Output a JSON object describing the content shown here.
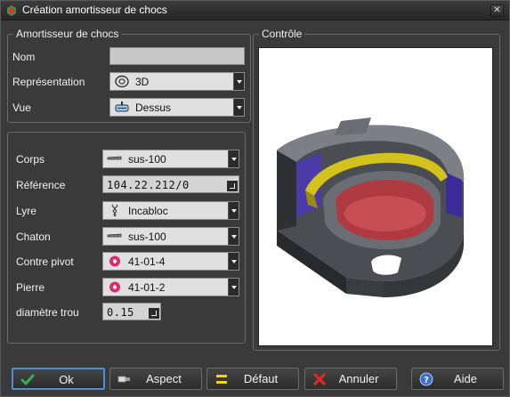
{
  "window": {
    "title": "Création amortisseur de chocs"
  },
  "group_amortisseur": {
    "legend": "Amortisseur de chocs",
    "nom_label": "Nom",
    "nom_value": "",
    "representation_label": "Représentation",
    "representation_value": "3D",
    "representation_icon": "disc-icon",
    "vue_label": "Vue",
    "vue_value": "Dessus",
    "vue_icon": "top-view-icon"
  },
  "group_params": {
    "corps_label": "Corps",
    "corps_value": "sus-100",
    "reference_label": "Référence",
    "reference_value": "104.22.212/0",
    "lyre_label": "Lyre",
    "lyre_value": "Incabloc",
    "chaton_label": "Chaton",
    "chaton_value": "sus-100",
    "contre_pivot_label": "Contre pivot",
    "contre_pivot_value": "41-01-4",
    "pierre_label": "Pierre",
    "pierre_value": "41-01-2",
    "diametre_label": "diamètre trou",
    "diametre_value": "0.15"
  },
  "group_controle": {
    "legend": "Contrôle"
  },
  "buttons": {
    "ok": "Ok",
    "aspect": "Aspect",
    "defaut": "Défaut",
    "annuler": "Annuler",
    "aide": "Aide"
  },
  "colors": {
    "ok_check": "#2fb34a",
    "cancel_x": "#e0282a",
    "jewel": "#e0286e",
    "help": "#3a6fd0",
    "default_yellow": "#f2d21c",
    "accent_border": "#4a8fd8"
  }
}
